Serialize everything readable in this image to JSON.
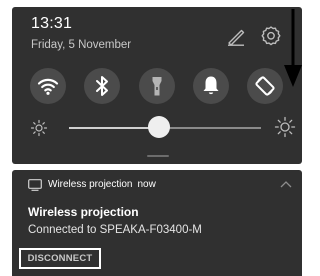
{
  "status": {
    "time": "13:31",
    "date": "Friday, 5 November"
  },
  "header_icons": [
    "edit-icon",
    "settings-icon"
  ],
  "quick_toggles": [
    {
      "name": "wifi",
      "icon": "wifi-icon",
      "active": true
    },
    {
      "name": "bluetooth",
      "icon": "bluetooth-icon",
      "active": true
    },
    {
      "name": "flashlight",
      "icon": "flashlight-icon",
      "active": false
    },
    {
      "name": "sound",
      "icon": "bell-icon",
      "active": true
    },
    {
      "name": "auto-rotate",
      "icon": "rotate-icon",
      "active": true
    }
  ],
  "brightness": {
    "level": 0.47,
    "low_icon": "brightness-low-icon",
    "high_icon": "brightness-high-icon"
  },
  "overlay": {
    "arrow": "down-arrow-icon",
    "arrow_color": "#000000"
  },
  "notification": {
    "app_icon": "cast-icon",
    "app_name": "Wireless projection",
    "time": "now",
    "title": "Wireless projection",
    "text": "Connected to SPEAKA-F03400-M",
    "action_label": "DISCONNECT"
  },
  "colors": {
    "panel_background": "#303030",
    "toggle_background": "#4b4b4b",
    "foreground": "#ffffff"
  }
}
